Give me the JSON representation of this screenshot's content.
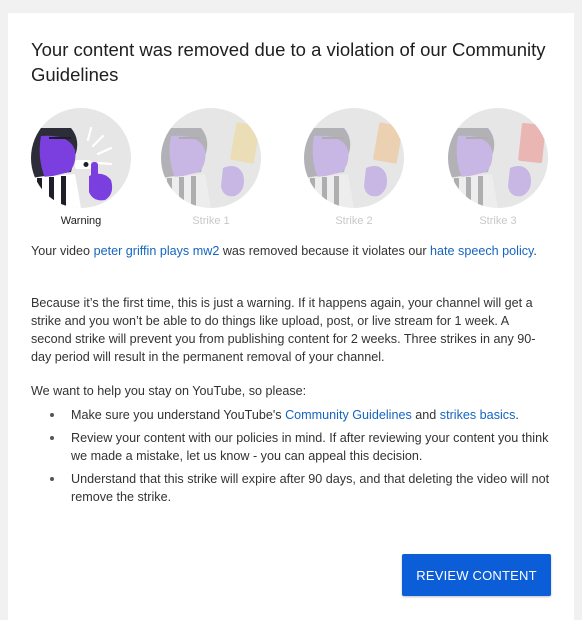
{
  "title": "Your content was removed due to a violation of our Community Guidelines",
  "strikes": [
    {
      "label": "Warning",
      "card_color": "#ffffff"
    },
    {
      "label": "Strike 1",
      "card_color": "#f6d05a"
    },
    {
      "label": "Strike 2",
      "card_color": "#f7a74e"
    },
    {
      "label": "Strike 3",
      "card_color": "#ef5a4f"
    }
  ],
  "intro": {
    "prefix": "Your video ",
    "video_title": "peter griffin plays mw2",
    "middle": " was removed because it violates our ",
    "policy_link": "hate speech policy",
    "suffix": "."
  },
  "explanation": "Because it’s the first time, this is just a warning. If it happens again, your channel will get a strike and you won’t be able to do things like upload, post, or live stream for 1 week. A second strike will prevent you from publishing content for 2 weeks. Three strikes in any 90-day period will result in the permanent removal of your channel.",
  "help_heading": "We want to help you stay on YouTube, so please:",
  "bullets": {
    "b1": {
      "prefix": "Make sure you understand YouTube's ",
      "link1": "Community Guidelines",
      "middle": " and ",
      "link2": "strikes basics",
      "suffix": "."
    },
    "b2": "Review your content with our policies in mind. If after reviewing your content you think we made a mistake, let us know - you can appeal this decision.",
    "b3": "Understand that this strike will expire after 90 days, and that deleting the video will not remove the strike."
  },
  "review_button": "REVIEW CONTENT",
  "colors": {
    "link": "#1565c0",
    "button": "#0b5ed7",
    "referee_skin": "#7b3fe0",
    "circle_bg": "#e6e6e6"
  }
}
